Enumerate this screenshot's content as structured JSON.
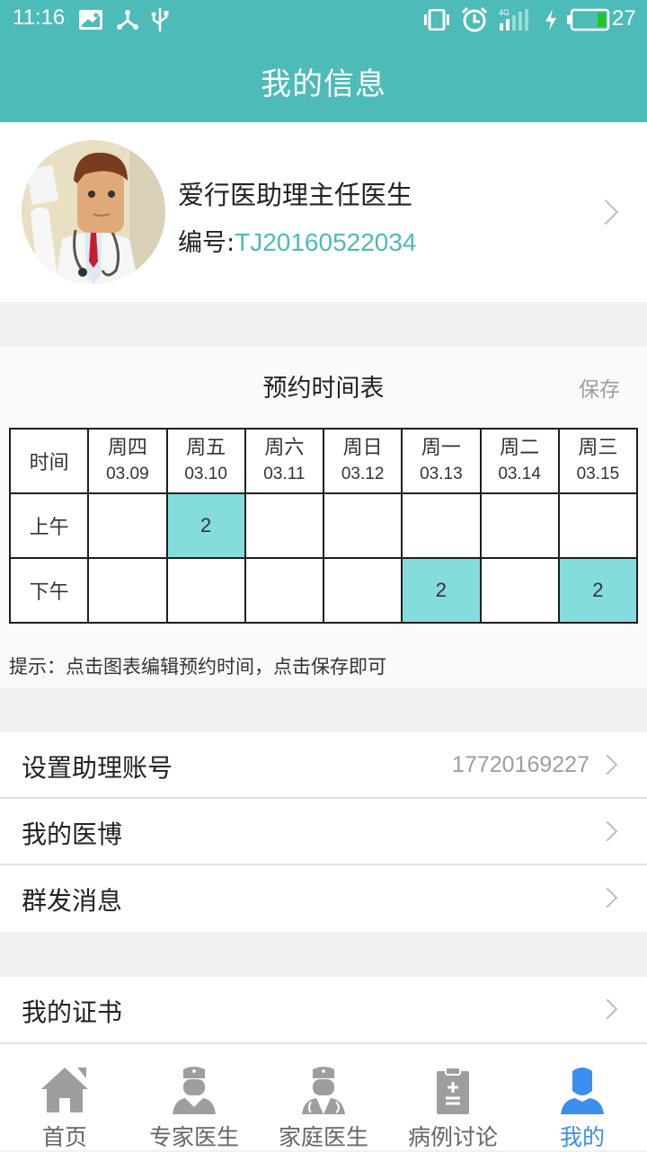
{
  "status_bar": {
    "time": "11:16",
    "battery_level": "27",
    "network": "4G",
    "icons": [
      "image-notification-icon",
      "share-hub-icon",
      "usb-icon",
      "vibrate-icon",
      "alarm-icon",
      "signal-4g-icon",
      "charging-icon",
      "battery-icon"
    ]
  },
  "header": {
    "title": "我的信息"
  },
  "profile": {
    "name": "爱行医助理主任医生",
    "id_label": "编号:",
    "id_value": "TJ20160522034"
  },
  "schedule": {
    "title": "预约时间表",
    "save_label": "保存",
    "time_header": "时间",
    "days": [
      {
        "day": "周四",
        "date": "03.09"
      },
      {
        "day": "周五",
        "date": "03.10"
      },
      {
        "day": "周六",
        "date": "03.11"
      },
      {
        "day": "周日",
        "date": "03.12"
      },
      {
        "day": "周一",
        "date": "03.13"
      },
      {
        "day": "周二",
        "date": "03.14"
      },
      {
        "day": "周三",
        "date": "03.15"
      }
    ],
    "rows": [
      {
        "label": "上午",
        "cells": [
          "",
          "2",
          "",
          "",
          "",
          "",
          ""
        ]
      },
      {
        "label": "下午",
        "cells": [
          "",
          "",
          "",
          "",
          "2",
          "",
          "2"
        ]
      }
    ],
    "hint": "提示：点击图表编辑预约时间，点击保存即可"
  },
  "menu_group1": [
    {
      "label": "设置助理账号",
      "value": "17720169227"
    },
    {
      "label": "我的医博",
      "value": ""
    },
    {
      "label": "群发消息",
      "value": ""
    }
  ],
  "menu_group2": [
    {
      "label": "我的证书",
      "value": ""
    }
  ],
  "tabs": [
    {
      "label": "首页",
      "icon": "home-icon",
      "active": false
    },
    {
      "label": "专家医生",
      "icon": "expert-doctor-icon",
      "active": false
    },
    {
      "label": "家庭医生",
      "icon": "family-doctor-icon",
      "active": false
    },
    {
      "label": "病例讨论",
      "icon": "case-clipboard-icon",
      "active": false
    },
    {
      "label": "我的",
      "icon": "user-icon",
      "active": true
    }
  ],
  "colors": {
    "brand": "#4dbbb7",
    "slot_selected": "#84dcdc",
    "tab_active": "#3b8fef",
    "tab_inactive": "#9e9e9e"
  }
}
